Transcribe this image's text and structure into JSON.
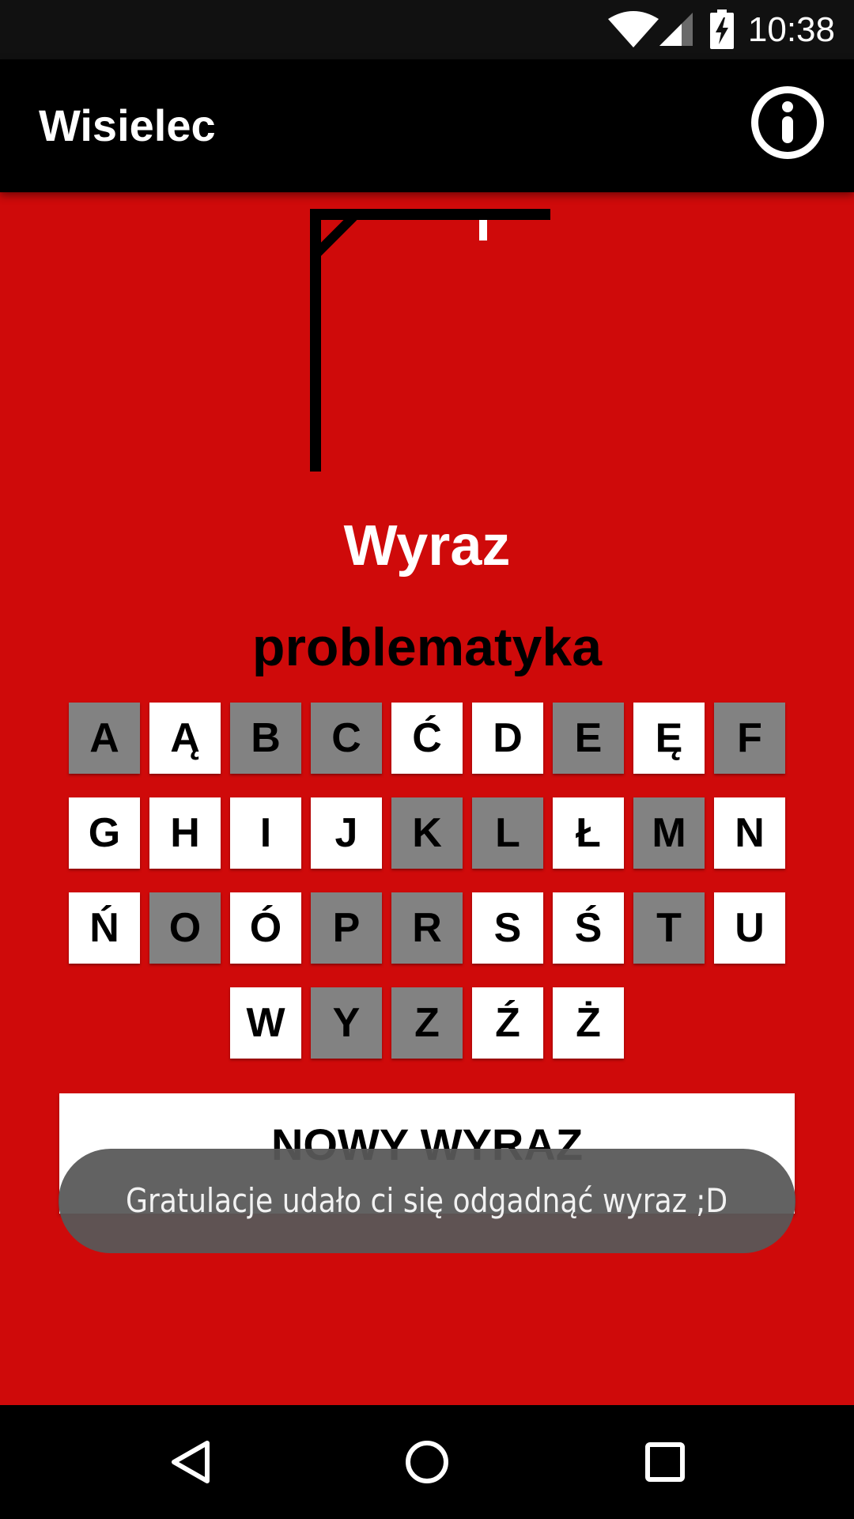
{
  "status_bar": {
    "time": "10:38",
    "icons": [
      "wifi-icon",
      "cell-signal-icon",
      "battery-charging-icon"
    ]
  },
  "app_bar": {
    "title": "Wisielec",
    "info_icon": "info-icon"
  },
  "game": {
    "word_label": "Wyraz",
    "word": "problematyka",
    "letters": [
      {
        "char": "A",
        "used": true
      },
      {
        "char": "Ą",
        "used": false
      },
      {
        "char": "B",
        "used": true
      },
      {
        "char": "C",
        "used": true
      },
      {
        "char": "Ć",
        "used": false
      },
      {
        "char": "D",
        "used": false
      },
      {
        "char": "E",
        "used": true
      },
      {
        "char": "Ę",
        "used": false
      },
      {
        "char": "F",
        "used": true
      },
      {
        "char": "G",
        "used": false
      },
      {
        "char": "H",
        "used": false
      },
      {
        "char": "I",
        "used": false
      },
      {
        "char": "J",
        "used": false
      },
      {
        "char": "K",
        "used": true
      },
      {
        "char": "L",
        "used": true
      },
      {
        "char": "Ł",
        "used": false
      },
      {
        "char": "M",
        "used": true
      },
      {
        "char": "N",
        "used": false
      },
      {
        "char": "Ń",
        "used": false
      },
      {
        "char": "O",
        "used": true
      },
      {
        "char": "Ó",
        "used": false
      },
      {
        "char": "P",
        "used": true
      },
      {
        "char": "R",
        "used": true
      },
      {
        "char": "S",
        "used": false
      },
      {
        "char": "Ś",
        "used": false
      },
      {
        "char": "T",
        "used": true
      },
      {
        "char": "U",
        "used": false
      },
      {
        "char": "W",
        "used": false
      },
      {
        "char": "Y",
        "used": true
      },
      {
        "char": "Z",
        "used": true
      },
      {
        "char": "Ź",
        "used": false
      },
      {
        "char": "Ż",
        "used": false
      }
    ],
    "new_word_label": "NOWY WYRAZ"
  },
  "toast": {
    "message": "Gratulacje udało ci się odgadnąć wyraz ;D"
  },
  "nav_bar": {
    "icons": [
      "back-icon",
      "home-icon",
      "recents-icon"
    ]
  },
  "colors": {
    "background": "#cf0a0a",
    "app_bar": "#000000",
    "key_used": "#828282",
    "key_free": "#ffffff",
    "toast": "#585858"
  }
}
